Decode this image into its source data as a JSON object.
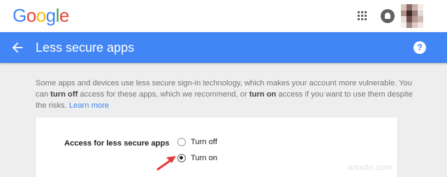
{
  "topbar": {
    "logo_letters": [
      {
        "ch": "G",
        "color": "#4285f4"
      },
      {
        "ch": "o",
        "color": "#ea4335"
      },
      {
        "ch": "o",
        "color": "#fbbc05"
      },
      {
        "ch": "g",
        "color": "#4285f4"
      },
      {
        "ch": "l",
        "color": "#34a853"
      },
      {
        "ch": "e",
        "color": "#ea4335"
      }
    ],
    "apps_icon": "apps-grid-icon",
    "notifications_icon": "notifications-bell-icon",
    "avatar_pixel_colors": [
      "#d9c7c2",
      "#8b6a63",
      "#c9b3ad",
      "#f2ece9",
      "#b69088",
      "#3d2a27",
      "#9a7d76",
      "#e5d8d4",
      "#e8dcd8",
      "#6e4f4a",
      "#b89b93",
      "#cdbab5",
      "#f5f0ee",
      "#a38a84",
      "#dbcac5",
      "#f0e8e5"
    ]
  },
  "header": {
    "title": "Less secure apps",
    "back_icon": "arrow-back-icon",
    "help_label": "?",
    "background": "#4285f4"
  },
  "description": {
    "part1": "Some apps and devices use less secure sign-in technology, which makes your account more vulnerable. You can ",
    "bold1": "turn off",
    "part2": " access for these apps, which we recommend, or ",
    "bold2": "turn on",
    "part3": " access if you want to use them despite the risks. ",
    "link": "Learn more"
  },
  "setting": {
    "label": "Access for less secure apps",
    "options": [
      {
        "label": "Turn off",
        "checked": false
      },
      {
        "label": "Turn on",
        "checked": true
      }
    ]
  },
  "annotation": {
    "arrow_color": "#e53935",
    "watermark": "wsxdn.com"
  }
}
